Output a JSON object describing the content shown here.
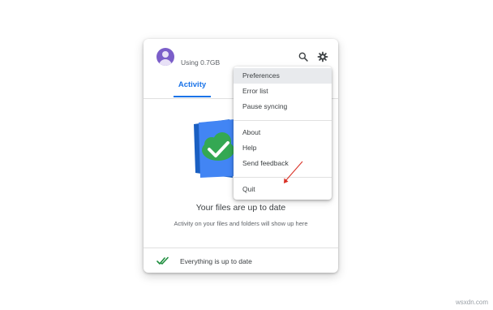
{
  "account": {
    "usage": "Using 0.7GB",
    "avatar_color": "#7b5ec9"
  },
  "header": {
    "search_icon": "search-icon",
    "settings_icon": "gear-icon"
  },
  "tabs": {
    "activity": "Activity"
  },
  "empty_state": {
    "illustration": "drive-sync-check",
    "title": "Your files are up to date",
    "subtitle": "Activity on your files and folders will show up here"
  },
  "footer": {
    "status": "Everything is up to date"
  },
  "menu": {
    "items": [
      {
        "label": "Preferences",
        "highlighted": true
      },
      {
        "label": "Error list"
      },
      {
        "label": "Pause syncing"
      },
      {
        "label": "About"
      },
      {
        "label": "Help"
      },
      {
        "label": "Send feedback"
      },
      {
        "label": "Quit"
      }
    ]
  },
  "annotation": {
    "color": "#d93025"
  },
  "watermark": "wsxdn.com",
  "colors": {
    "accent": "#1a73e8",
    "check_green": "#1e8e3e"
  }
}
